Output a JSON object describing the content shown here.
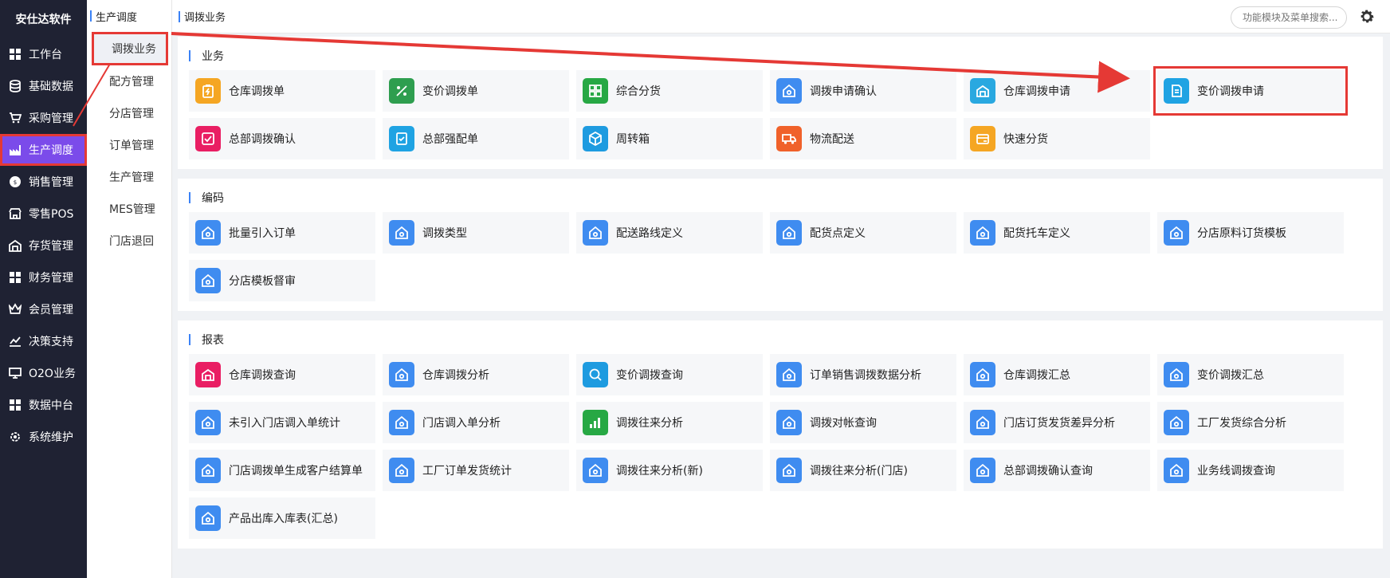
{
  "brand": "安仕达软件",
  "sidebar": [
    {
      "label": "工作台",
      "icon": "grid-icon"
    },
    {
      "label": "基础数据",
      "icon": "database-icon"
    },
    {
      "label": "采购管理",
      "icon": "cart-icon"
    },
    {
      "label": "生产调度",
      "icon": "factory-icon",
      "active": true
    },
    {
      "label": "销售管理",
      "icon": "sale-icon"
    },
    {
      "label": "零售POS",
      "icon": "store-icon"
    },
    {
      "label": "存货管理",
      "icon": "warehouse-icon"
    },
    {
      "label": "财务管理",
      "icon": "grid-icon"
    },
    {
      "label": "会员管理",
      "icon": "crown-icon"
    },
    {
      "label": "决策支持",
      "icon": "chart-icon"
    },
    {
      "label": "O2O业务",
      "icon": "monitor-icon"
    },
    {
      "label": "数据中台",
      "icon": "grid-icon"
    },
    {
      "label": "系统维护",
      "icon": "gear-icon"
    }
  ],
  "subnav": {
    "title": "生产调度",
    "items": [
      "调拨业务",
      "配方管理",
      "分店管理",
      "订单管理",
      "生产管理",
      "MES管理",
      "门店退回"
    ]
  },
  "header": {
    "breadcrumb": "调拨业务",
    "search_placeholder": "功能模块及菜单搜索..."
  },
  "sections": [
    {
      "title": "业务",
      "tiles": [
        {
          "label": "仓库调拨单",
          "icon": "clipboard-icon",
          "color": "#f5a623"
        },
        {
          "label": "变价调拨单",
          "icon": "percent-icon",
          "color": "#2e9e4f"
        },
        {
          "label": "综合分货",
          "icon": "apps-icon",
          "color": "#27a844"
        },
        {
          "label": "调拨申请确认",
          "icon": "house-icon",
          "color": "#3f8cf0"
        },
        {
          "label": "仓库调拨申请",
          "icon": "warehouse-icon",
          "color": "#29a8e0"
        },
        {
          "label": "变价调拨申请",
          "icon": "doc-icon",
          "color": "#1fa3e3",
          "highlight": true
        },
        {
          "label": "总部调拨确认",
          "icon": "check-icon",
          "color": "#e91e63"
        },
        {
          "label": "总部强配单",
          "icon": "form-icon",
          "color": "#1fa3e3"
        },
        {
          "label": "周转箱",
          "icon": "box-icon",
          "color": "#1e9be0"
        },
        {
          "label": "物流配送",
          "icon": "truck-icon",
          "color": "#f0612a"
        },
        {
          "label": "快速分货",
          "icon": "card-icon",
          "color": "#f5a623"
        }
      ]
    },
    {
      "title": "编码",
      "tiles": [
        {
          "label": "批量引入订单",
          "icon": "house-icon",
          "color": "#3f8cf0"
        },
        {
          "label": "调拨类型",
          "icon": "house-icon",
          "color": "#3f8cf0"
        },
        {
          "label": "配送路线定义",
          "icon": "house-icon",
          "color": "#3f8cf0"
        },
        {
          "label": "配货点定义",
          "icon": "house-icon",
          "color": "#3f8cf0"
        },
        {
          "label": "配货托车定义",
          "icon": "house-icon",
          "color": "#3f8cf0"
        },
        {
          "label": "分店原料订货模板",
          "icon": "house-icon",
          "color": "#3f8cf0"
        },
        {
          "label": "分店模板督审",
          "icon": "house-icon",
          "color": "#3f8cf0"
        }
      ]
    },
    {
      "title": "报表",
      "tiles": [
        {
          "label": "仓库调拨查询",
          "icon": "warehouse-icon",
          "color": "#e91e63"
        },
        {
          "label": "仓库调拨分析",
          "icon": "house-icon",
          "color": "#3f8cf0"
        },
        {
          "label": "变价调拨查询",
          "icon": "magnifier-icon",
          "color": "#1e9be0"
        },
        {
          "label": "订单销售调拨数据分析",
          "icon": "house-icon",
          "color": "#3f8cf0"
        },
        {
          "label": "仓库调拨汇总",
          "icon": "house-icon",
          "color": "#3f8cf0"
        },
        {
          "label": "变价调拨汇总",
          "icon": "house-icon",
          "color": "#3f8cf0"
        },
        {
          "label": "未引入门店调入单统计",
          "icon": "house-icon",
          "color": "#3f8cf0"
        },
        {
          "label": "门店调入单分析",
          "icon": "house-icon",
          "color": "#3f8cf0"
        },
        {
          "label": "调拨往来分析",
          "icon": "bars-icon",
          "color": "#27a844"
        },
        {
          "label": "调拨对帐查询",
          "icon": "house-icon",
          "color": "#3f8cf0"
        },
        {
          "label": "门店订货发货差异分析",
          "icon": "house-icon",
          "color": "#3f8cf0"
        },
        {
          "label": "工厂发货综合分析",
          "icon": "house-icon",
          "color": "#3f8cf0"
        },
        {
          "label": "门店调拨单生成客户结算单",
          "icon": "house-icon",
          "color": "#3f8cf0"
        },
        {
          "label": "工厂订单发货统计",
          "icon": "house-icon",
          "color": "#3f8cf0"
        },
        {
          "label": "调拨往来分析(新)",
          "icon": "house-icon",
          "color": "#3f8cf0"
        },
        {
          "label": "调拨往来分析(门店)",
          "icon": "house-icon",
          "color": "#3f8cf0"
        },
        {
          "label": "总部调拨确认查询",
          "icon": "house-icon",
          "color": "#3f8cf0"
        },
        {
          "label": "业务线调拨查询",
          "icon": "house-icon",
          "color": "#3f8cf0"
        },
        {
          "label": "产品出库入库表(汇总)",
          "icon": "house-icon",
          "color": "#3f8cf0"
        }
      ]
    }
  ]
}
